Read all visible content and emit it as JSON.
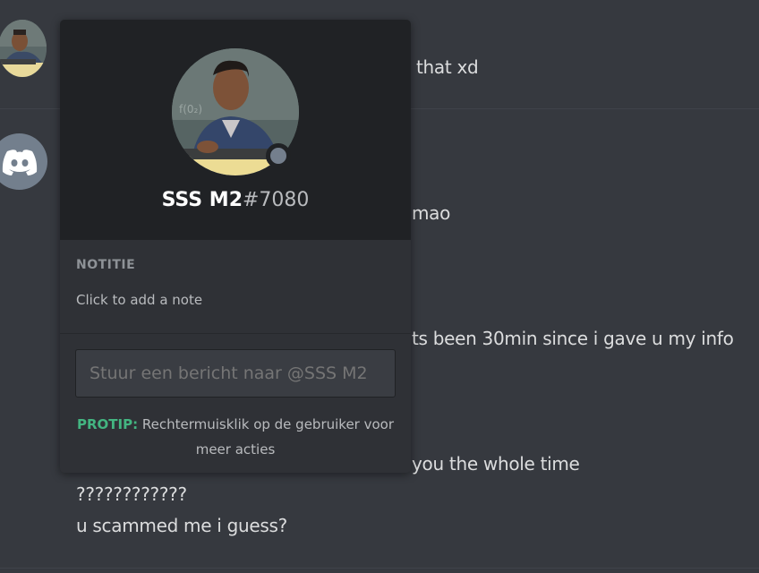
{
  "messages": [
    {
      "text": "that xd"
    },
    {
      "text": "mao"
    },
    {
      "text": "ts been 30min since i gave u my info"
    },
    {
      "text": "you the whole time"
    },
    {
      "text": "????????????"
    },
    {
      "text": "u scammed me i guess?"
    }
  ],
  "popout": {
    "username": "SSS M2",
    "discriminator": "#7080",
    "note_title": "NOTITIE",
    "note_placeholder": "Click to add a note",
    "dm_placeholder": "Stuur een bericht naar @SSS M2",
    "protip_label": "PROTIP:",
    "protip_text": "Rechtermuisklik op de gebruiker voor meer acties"
  },
  "colors": {
    "background": "#36393f",
    "popout_header": "#202225",
    "popout_body": "#2f3136",
    "protip": "#43b581",
    "status_offline": "#747f8d"
  }
}
